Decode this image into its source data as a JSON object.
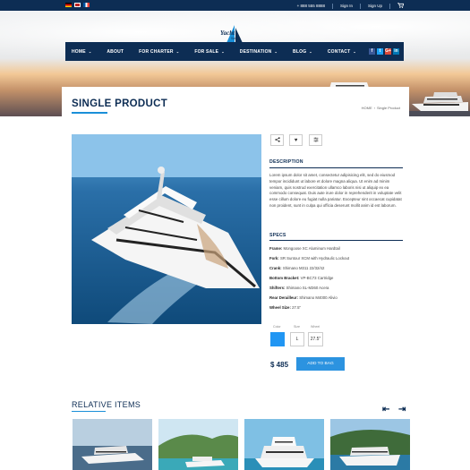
{
  "topbar": {
    "phone": "+ 888 555 8888",
    "sign_in": "Sign In",
    "sign_up": "Sign Up"
  },
  "logo": {
    "text": "Yacht",
    "sub": "Sailing"
  },
  "nav": {
    "items": [
      {
        "label": "HOME",
        "dropdown": true
      },
      {
        "label": "ABOUT",
        "dropdown": false
      },
      {
        "label": "FOR CHARTER",
        "dropdown": true
      },
      {
        "label": "FOR SALE",
        "dropdown": true
      },
      {
        "label": "DESTINATION",
        "dropdown": true
      },
      {
        "label": "BLOG",
        "dropdown": true
      },
      {
        "label": "CONTACT",
        "dropdown": true
      }
    ],
    "social": [
      "f",
      "t",
      "G+",
      "in"
    ]
  },
  "page": {
    "title": "SINGLE PRODUCT",
    "breadcrumb_home": "HOME",
    "breadcrumb_current": "Single Product"
  },
  "product": {
    "description_title": "DESCRIPTION",
    "description": "Lorem ipsum dolor sit amet, consectetur adipisicing elit, sed do eiusmod tempor incididunt ut labore et dolore magna aliqua. Ut enim ad minim veniam, quis nostrud exercitation ullamco laboris nisi ut aliquip ex ea commodo consequat. Duis aute irure dolor in reprehenderit in voluptate velit esse cillum dolore eu fugiat nulla pariatur. Excepteur sint occaecat cupidatat non proident, sunt in culpa qui officia deserunt mollit anim id est laborum.",
    "specs_title": "SPECS",
    "specs": [
      {
        "label": "Frame:",
        "value": "Mongoose XC Aluminum Hardtail"
      },
      {
        "label": "Fork:",
        "value": "SR Suntour XCM with Hydraulic Lockout"
      },
      {
        "label": "Crank:",
        "value": "Shimano M311 22/32/42"
      },
      {
        "label": "Bottom Bracket:",
        "value": "VP-BC73 Cartridge"
      },
      {
        "label": "Shifters:",
        "value": "Shimano SL-M360 Acera"
      },
      {
        "label": "Rear Derailleur:",
        "value": "Shimano M4000 Alivio"
      },
      {
        "label": "Wheel Size:",
        "value": "27.5\""
      }
    ],
    "options": {
      "color_label": "Color",
      "size_label": "Size",
      "wheel_label": "Wheel",
      "color_value": "#2196f3",
      "size_value": "L",
      "wheel_value": "27.5\""
    },
    "price": "$ 485",
    "add_to_bag": "ADD TO BAG"
  },
  "related": {
    "title": "RELATIVE ITEMS"
  },
  "colors": {
    "navy": "#0d2d54",
    "accent": "#2c93e0"
  }
}
